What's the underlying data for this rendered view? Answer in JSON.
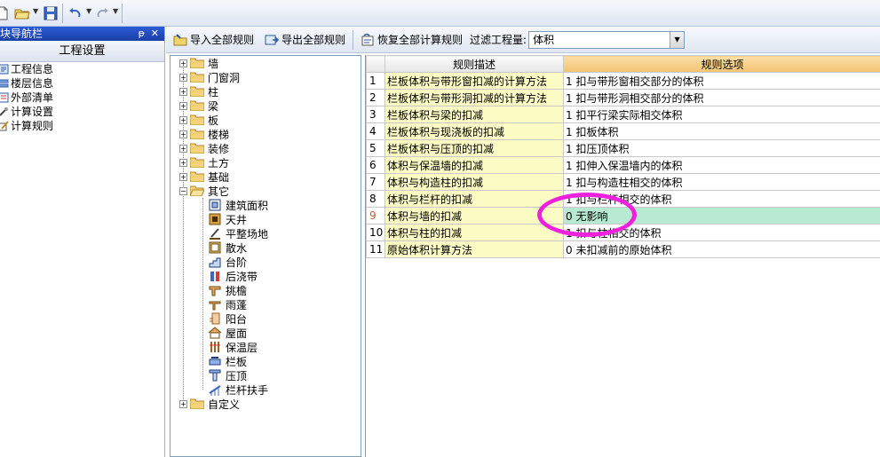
{
  "colors": {
    "title_bar": "#1b3fa8",
    "desc_cell": "#fbfbc4",
    "selected_row": "#b8ead3",
    "option_header": "#f4c272",
    "highlight_ellipse": "#ee22dd"
  },
  "quick_toolbar": {
    "icons": [
      "new-icon",
      "open-icon",
      "save-icon",
      "undo-icon",
      "redo-icon"
    ]
  },
  "nav_pane": {
    "title": "模块导航栏",
    "pin": "ᵽ",
    "close": "✕",
    "header": "工程设置",
    "items": [
      {
        "label": "工程信息",
        "icon": "project-info-icon"
      },
      {
        "label": "楼层信息",
        "icon": "floor-info-icon"
      },
      {
        "label": "外部清单",
        "icon": "external-list-icon"
      },
      {
        "label": "计算设置",
        "icon": "calc-settings-icon"
      },
      {
        "label": "计算规则",
        "icon": "calc-rules-icon"
      }
    ]
  },
  "toolbar": {
    "import_label": "导入全部规则",
    "export_label": "导出全部规则",
    "restore_label": "恢复全部计算规则",
    "filter_label": "过滤工程量:",
    "filter_value": "体积"
  },
  "tree": {
    "folders": [
      "墙",
      "门窗洞",
      "柱",
      "梁",
      "板",
      "楼梯",
      "装修",
      "土方",
      "基础",
      "其它"
    ],
    "other_children": [
      "建筑面积",
      "天井",
      "平整场地",
      "散水",
      "台阶",
      "后浇带",
      "挑檐",
      "雨蓬",
      "阳台",
      "屋面",
      "保温层",
      "栏板",
      "压顶",
      "栏杆扶手"
    ],
    "last_folder": "自定义",
    "expand_plus": "+",
    "expand_minus": "−"
  },
  "grid": {
    "headers": {
      "desc": "规则描述",
      "option": "规则选项"
    },
    "rows": [
      {
        "num": "1",
        "desc": "栏板体积与带形窗扣减的计算方法",
        "value": "1 扣与带形窗相交部分的体积"
      },
      {
        "num": "2",
        "desc": "栏板体积与带形洞扣减的计算方法",
        "value": "1 扣与带形洞相交部分的体积"
      },
      {
        "num": "3",
        "desc": "栏板体积与梁的扣减",
        "value": "1 扣平行梁实际相交体积"
      },
      {
        "num": "4",
        "desc": "栏板体积与现浇板的扣减",
        "value": "1 扣板体积"
      },
      {
        "num": "5",
        "desc": "栏板体积与压顶的扣减",
        "value": "1 扣压顶体积"
      },
      {
        "num": "6",
        "desc": "体积与保温墙的扣减",
        "value": "1 扣伸入保温墙内的体积"
      },
      {
        "num": "7",
        "desc": "体积与构造柱的扣减",
        "value": "1 扣与构造柱相交的体积"
      },
      {
        "num": "8",
        "desc": "体积与栏杆的扣减",
        "value": "1 扣与栏杆相交的体积"
      },
      {
        "num": "9",
        "desc": "体积与墙的扣减",
        "value": "0  无影响"
      },
      {
        "num": "10",
        "desc": "体积与柱的扣减",
        "value": "1 扣与柱相交的体积"
      },
      {
        "num": "11",
        "desc": "原始体积计算方法",
        "value": "0 未扣减前的原始体积"
      }
    ],
    "selected_row": "9"
  }
}
